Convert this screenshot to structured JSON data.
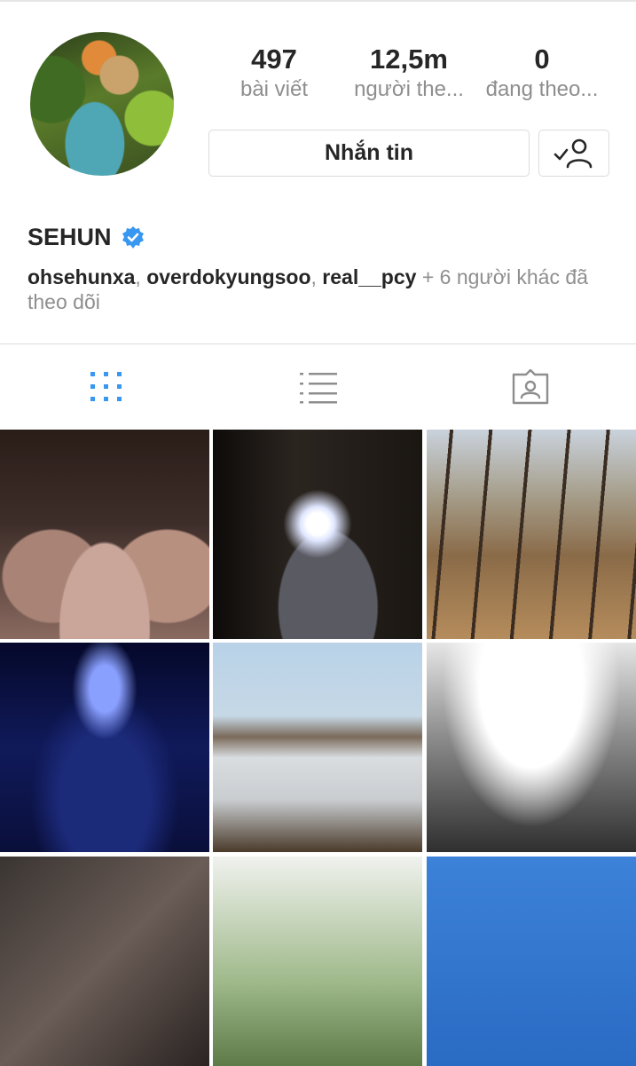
{
  "profile": {
    "username": "SEHUN",
    "verified_icon": "verified-badge-icon",
    "avatar_icon": "profile-photo"
  },
  "stats": {
    "posts_count": "497",
    "posts_label": "bài viết",
    "followers_count": "12,5m",
    "followers_label": "người the...",
    "following_count": "0",
    "following_label": "đang theo..."
  },
  "actions": {
    "message_label": "Nhắn tin",
    "follow_icon": "following-user-check-icon"
  },
  "followed_by": {
    "user1": "ohsehunxa",
    "sep1": ", ",
    "user2": "overdokyungsoo",
    "sep2": ", ",
    "user3": "real__pcy",
    "rest": " + 6 người khác đã theo dõi"
  },
  "tabs": [
    {
      "icon": "grid-icon",
      "active": true
    },
    {
      "icon": "list-icon",
      "active": false
    },
    {
      "icon": "tagged-icon",
      "active": false
    }
  ],
  "colors": {
    "accent": "#3897f0",
    "muted": "#8e8e8e",
    "text": "#262626",
    "border": "#dbdbdb"
  },
  "grid_posts_visible": 9
}
